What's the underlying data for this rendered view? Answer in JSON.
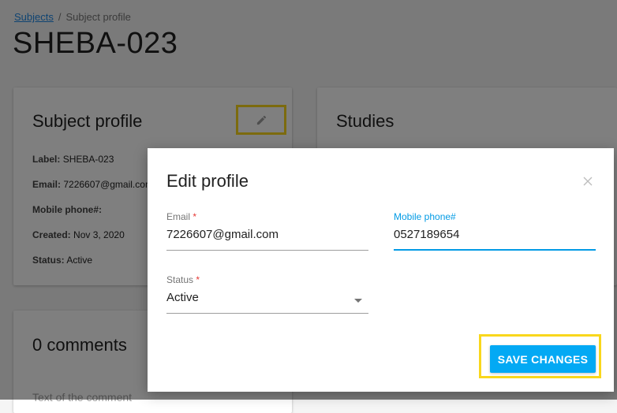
{
  "breadcrumb": {
    "link": "Subjects",
    "separator": "/",
    "current": "Subject profile"
  },
  "page": {
    "title": "SHEBA-023"
  },
  "profile_card": {
    "title": "Subject profile",
    "fields": [
      {
        "label": "Label:",
        "value": "SHEBA-023"
      },
      {
        "label": "Email:",
        "value": "7226607@gmail.com"
      },
      {
        "label": "Mobile phone#:",
        "value": ""
      },
      {
        "label": "Created:",
        "value": "Nov 3, 2020"
      },
      {
        "label": "Status:",
        "value": "Active"
      }
    ]
  },
  "studies_card": {
    "title": "Studies"
  },
  "comments_card": {
    "title": "0 comments",
    "placeholder": "Text of the comment"
  },
  "dialog": {
    "title": "Edit profile",
    "email": {
      "label": "Email",
      "required_mark": "*",
      "value": "7226607@gmail.com"
    },
    "phone": {
      "label": "Mobile phone#",
      "value": "0527189654"
    },
    "status": {
      "label": "Status",
      "required_mark": "*",
      "value": "Active"
    },
    "save_label": "SAVE CHANGES"
  },
  "colors": {
    "accent": "#03a9f4",
    "highlight": "#f9d71c",
    "link": "#1e88e5",
    "required": "#e53935"
  }
}
